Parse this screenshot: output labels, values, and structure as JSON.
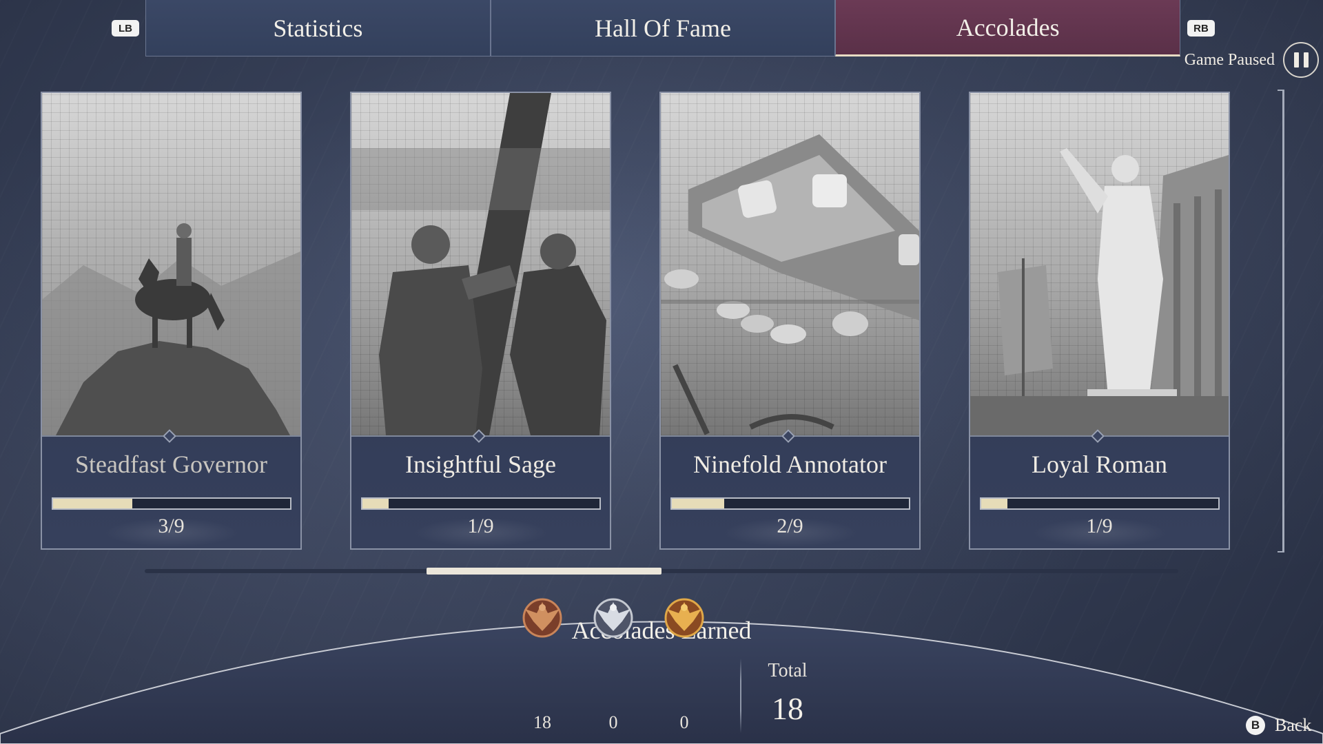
{
  "tabs": {
    "left_button": "LB",
    "right_button": "RB",
    "items": [
      {
        "label": "Statistics",
        "active": false
      },
      {
        "label": "Hall Of Fame",
        "active": false
      },
      {
        "label": "Accolades",
        "active": true
      }
    ]
  },
  "pause": {
    "label": "Game Paused",
    "icon": "pause-icon"
  },
  "cards": [
    {
      "title": "Steadfast Governor",
      "count": "3/9",
      "progress": 0.333,
      "art": "horseman-on-cliff"
    },
    {
      "title": "Insightful Sage",
      "count": "1/9",
      "progress": 0.111,
      "art": "man-with-cross"
    },
    {
      "title": "Ninefold Annotator",
      "count": "2/9",
      "progress": 0.222,
      "art": "dice-and-coins"
    },
    {
      "title": "Loyal Roman",
      "count": "1/9",
      "progress": 0.111,
      "art": "statue-and-temple"
    }
  ],
  "scroll": {
    "horizontal_position": 0.27,
    "horizontal_thumb_size": 0.23
  },
  "earned": {
    "title": "Accolades Earned",
    "medals": [
      {
        "tier": "bronze",
        "icon": "bronze-eagle-medal-icon",
        "count": "18"
      },
      {
        "tier": "silver",
        "icon": "silver-eagle-medal-icon",
        "count": "0"
      },
      {
        "tier": "gold",
        "icon": "gold-eagle-medal-icon",
        "count": "0"
      }
    ],
    "total_label": "Total",
    "total_value": "18"
  },
  "back": {
    "button": "B",
    "label": "Back"
  },
  "colors": {
    "active_tab": "#5a3048",
    "tab": "#33405c",
    "progress_fill": "#e6dcb8",
    "bronze": "#b8663a",
    "silver": "#c4c8d0",
    "gold": "#d49a3a"
  }
}
